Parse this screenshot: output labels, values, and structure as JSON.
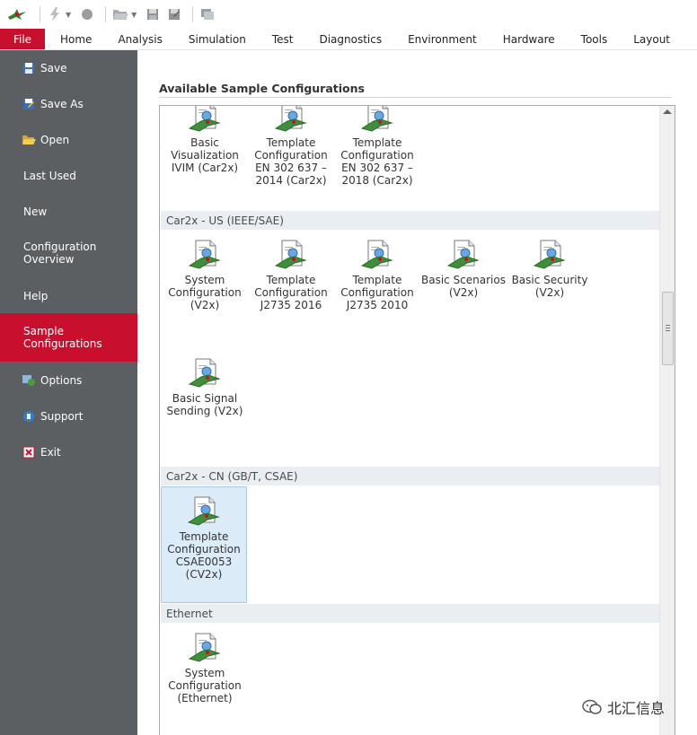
{
  "quick_access": {
    "icons": [
      "app-logo-icon",
      "lightning-icon",
      "record-icon",
      "open-folder-icon",
      "save-icon",
      "save-as-icon",
      "configuration-icon"
    ]
  },
  "ribbon": {
    "file_tab": "File",
    "tabs": [
      "Home",
      "Analysis",
      "Simulation",
      "Test",
      "Diagnostics",
      "Environment",
      "Hardware",
      "Tools",
      "Layout"
    ]
  },
  "sidebar": {
    "items": [
      {
        "label": "Save",
        "icon": "save-icon"
      },
      {
        "label": "Save As",
        "icon": "save-as-icon"
      },
      {
        "label": "Open",
        "icon": "open-folder-icon"
      },
      {
        "label": "Last Used",
        "icon": ""
      },
      {
        "label": "New",
        "icon": ""
      },
      {
        "label": "Configuration\nOverview",
        "icon": ""
      },
      {
        "label": "Help",
        "icon": ""
      },
      {
        "label": "Sample\nConfigurations",
        "icon": "",
        "active": true
      },
      {
        "label": "Options",
        "icon": "options-icon"
      },
      {
        "label": "Support",
        "icon": "support-icon"
      },
      {
        "label": "Exit",
        "icon": "exit-icon"
      }
    ]
  },
  "main": {
    "title": "Available Sample Configurations",
    "groups": [
      {
        "header": "",
        "items": [
          "Basic\nVisualization\nIVIM (Car2x)",
          "Template\nConfiguration\nEN 302 637 –\n2014 (Car2x)",
          "Template\nConfiguration\nEN 302 637 –\n2018 (Car2x)"
        ]
      },
      {
        "header": "Car2x - US (IEEE/SAE)",
        "items": [
          "System\nConfiguration\n(V2x)",
          "Template\nConfiguration\nJ2735 2016",
          "Template\nConfiguration\nJ2735 2010",
          "Basic Scenarios\n(V2x)",
          "Basic Security\n(V2x)",
          "Basic Signal\nSending (V2x)"
        ]
      },
      {
        "header": "Car2x - CN (GB/T, CSAE)",
        "items": [
          "Template\nConfiguration\nCSAE0053\n(CV2x)"
        ]
      },
      {
        "header": "Ethernet",
        "items": [
          "System\nConfiguration\n(Ethernet)"
        ]
      }
    ]
  },
  "watermark": {
    "text": "北汇信息"
  },
  "colors": {
    "accent": "#c8102e",
    "sidebar": "#5c5f62",
    "group_header": "#e9eef2",
    "selection": "#dcebf8"
  }
}
